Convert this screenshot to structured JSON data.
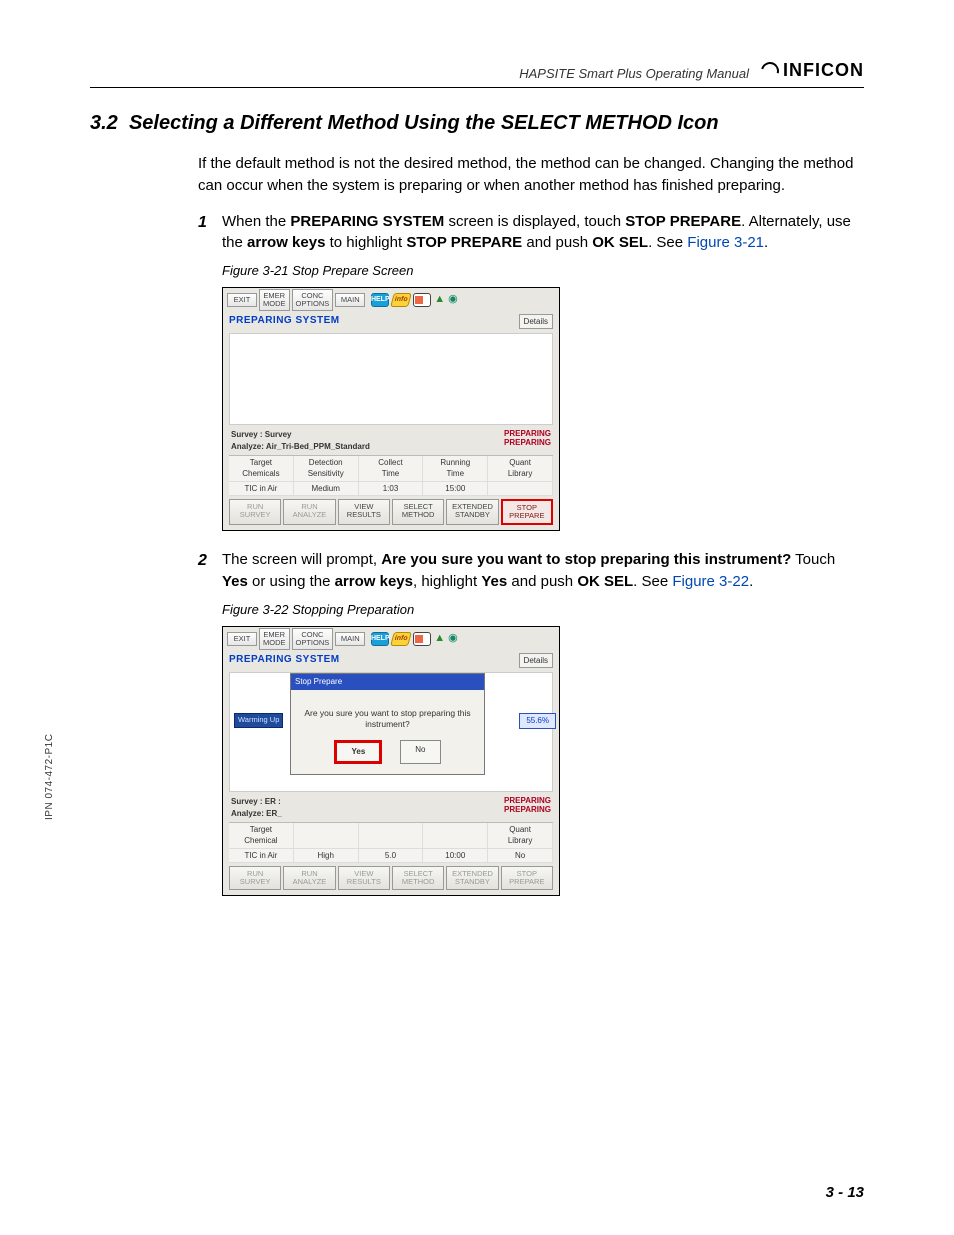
{
  "header": {
    "running_title": "HAPSITE Smart Plus Operating Manual",
    "brand": "INFICON"
  },
  "side_label": "IPN 074-472-P1C",
  "section": {
    "number": "3.2",
    "title": "Selecting a Different Method Using the SELECT METHOD Icon"
  },
  "intro": "If the default method is not the desired method, the method can be changed. Changing the method can occur when the system is preparing or when another method has finished preparing.",
  "steps": [
    {
      "n": "1",
      "text_pre": "When the ",
      "b1": "PREPARING SYSTEM",
      "text_mid1": " screen is displayed, touch ",
      "b2": "STOP PREPARE",
      "text_mid2": ". Alternately, use the ",
      "b3": "arrow keys",
      "text_mid3": " to highlight ",
      "b4": "STOP PREPARE",
      "text_mid4": " and push ",
      "b5": "OK SEL",
      "text_end": ". See ",
      "figref": "Figure 3-21",
      "dot": "."
    },
    {
      "n": "2",
      "text_pre": "The screen will prompt, ",
      "b1": "Are you sure you want to stop preparing this instrument?",
      "text_mid1": " Touch ",
      "b2": "Yes",
      "text_mid2": " or using the ",
      "b3": "arrow keys",
      "text_mid3": ", highlight ",
      "b4": "Yes",
      "text_mid4": " and push ",
      "b5": "OK SEL",
      "text_end": ". See ",
      "figref": "Figure 3-22",
      "dot": "."
    }
  ],
  "fig21": {
    "caption": "Figure 3-21  Stop Prepare Screen",
    "top_buttons": [
      "EXIT",
      "EMER\nMODE",
      "CONC\nOPTIONS",
      "MAIN"
    ],
    "status": "PREPARING SYSTEM",
    "details": "Details",
    "info_left": [
      "Survey : Survey",
      "Analyze: Air_Tri-Bed_PPM_Standard"
    ],
    "info_right": [
      "PREPARING",
      "PREPARING"
    ],
    "table_headers": [
      "Target\nChemicals",
      "Detection\nSensitivity",
      "Collect\nTime",
      "Running\nTime",
      "Quant\nLibrary"
    ],
    "table_values": [
      "TIC in Air",
      "Medium",
      "1:03",
      "15:00",
      ""
    ],
    "bottom_buttons": [
      "RUN\nSURVEY",
      "RUN\nANALYZE",
      "VIEW\nRESULTS",
      "SELECT\nMETHOD",
      "EXTENDED\nSTANDBY",
      "STOP\nPREPARE"
    ]
  },
  "fig22": {
    "caption": "Figure 3-22  Stopping Preparation",
    "top_buttons": [
      "EXIT",
      "EMER\nMODE",
      "CONC\nOPTIONS",
      "MAIN"
    ],
    "status": "PREPARING SYSTEM",
    "details": "Details",
    "warming": "Warming Up",
    "pct": "55.6%",
    "modal_title": "Stop Prepare",
    "modal_text": "Are you sure you want to stop preparing this instrument?",
    "yes": "Yes",
    "no": "No",
    "info_left": [
      "Survey : ER :",
      "Analyze: ER_"
    ],
    "info_right": [
      "PREPARING",
      "PREPARING"
    ],
    "table_headers": [
      "Target\nChemical",
      "",
      "",
      "",
      "Quant\nLibrary"
    ],
    "table_values": [
      "TIC in Air",
      "High",
      "5.0",
      "10:00",
      "No"
    ],
    "bottom_buttons": [
      "RUN\nSURVEY",
      "RUN\nANALYZE",
      "VIEW\nRESULTS",
      "SELECT\nMETHOD",
      "EXTENDED\nSTANDBY",
      "STOP\nPREPARE"
    ]
  },
  "footer_page": "3 - 13"
}
